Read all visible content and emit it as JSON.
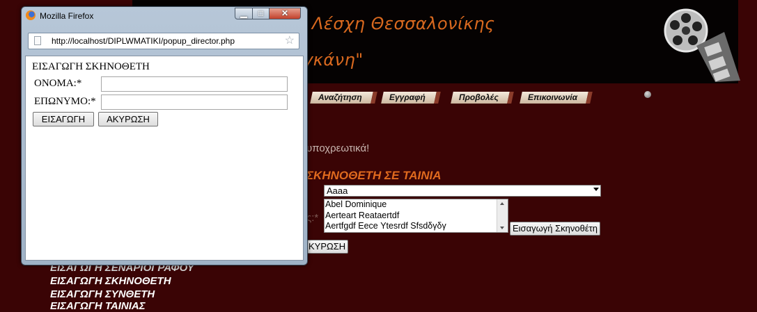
{
  "background": {
    "banner": {
      "line1": "Λέσχη Θεσσαλονίκης",
      "line2": "γκάνη\""
    },
    "nav": [
      "Αναζήτηση",
      "Εγγραφή",
      "Προβολές",
      "Επικοινωνία"
    ],
    "notice": "υποχρεωτικά!",
    "heading": "ΣΚΗΝΟΘΕΤΗ ΣΕ ΤΑΙΝΙΑ",
    "film_select": {
      "selected": "Aaaa"
    },
    "director_list": {
      "options": [
        "Abel Dominique",
        "Aerteart Reataertdf",
        "Aertfgdf Eecе Ytesrdf Sfsdδγδγ"
      ]
    },
    "label_partial": "ς:*",
    "insert_director_button": "Εισαγωγή Σκηνοθέτη",
    "cancel_button_partial": "ΚΥΡΩΣΗ",
    "side_links": [
      "ΕΙΣΑΓΩΓΗ ΣΕΝΑΡΙΟΓΡΑΦΟΥ",
      "ΕΙΣΑΓΩΓΗ ΣΚΗΝΟΘΕΤΗ",
      "ΕΙΣΑΓΩΓΗ ΣΥΝΘΕΤΗ",
      "ΕΙΣΑΓΩΓΗ ΤΑΙΝΙΑΣ"
    ]
  },
  "popup": {
    "window_title": "Mozilla Firefox",
    "url": "http://localhost/DIPLWMATIKI/popup_director.php",
    "controls": {
      "minimize_icon": "minimize-icon",
      "maximize_icon": "maximize-icon",
      "close_icon": "close-icon"
    },
    "form": {
      "title": "ΕΙΣΑΓΩΓΗ ΣΚΗΝΟΘΕΤΗ",
      "first_name_label": "ΟΝΟΜΑ:*",
      "first_name_value": "",
      "last_name_label": "ΕΠΩΝΥΜΟ:*",
      "last_name_value": "",
      "submit_label": "ΕΙΣΑΓΩΓΗ",
      "cancel_label": "ΑΚΥΡΩΣΗ"
    }
  },
  "colors": {
    "page_background": "#3a0405",
    "heading_orange": "#e06a1e",
    "banner_text": "#d9691f"
  }
}
